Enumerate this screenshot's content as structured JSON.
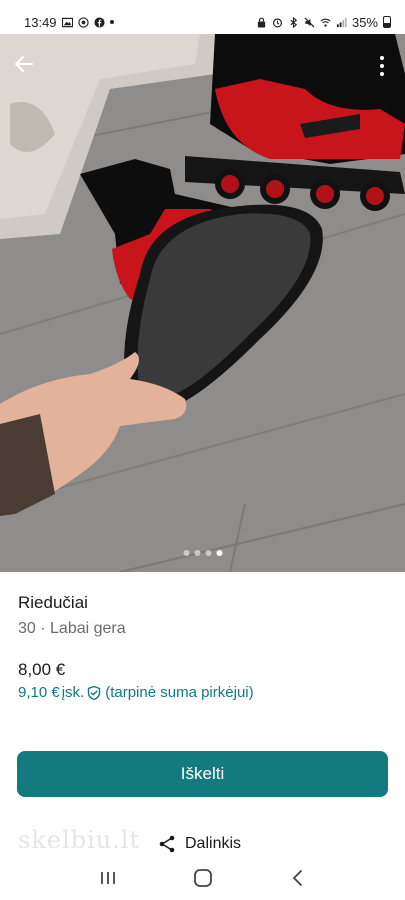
{
  "status_bar": {
    "time": "13:49",
    "battery": "35%"
  },
  "listing": {
    "title": "Riedučiai",
    "size": "30",
    "separator": "·",
    "condition": "Labai gera",
    "price": "8,00 €",
    "buyer_price": "9,10 €",
    "buyer_price_note": "įsk.",
    "buyer_price_detail": "(tarpinė suma pirkėjui)",
    "photo_count": 4,
    "active_photo": 4
  },
  "actions": {
    "primary_label": "Iškelti",
    "share_label": "Dalinkis"
  },
  "watermark": "skelbiu.lt",
  "colors": {
    "accent": "#137b80",
    "accent_text": "#0f7a80",
    "skate_red": "#c8141b"
  },
  "icons": {
    "back": "arrow-left-icon",
    "more": "more-vertical-icon",
    "share": "share-icon",
    "shield": "shield-check-icon"
  }
}
